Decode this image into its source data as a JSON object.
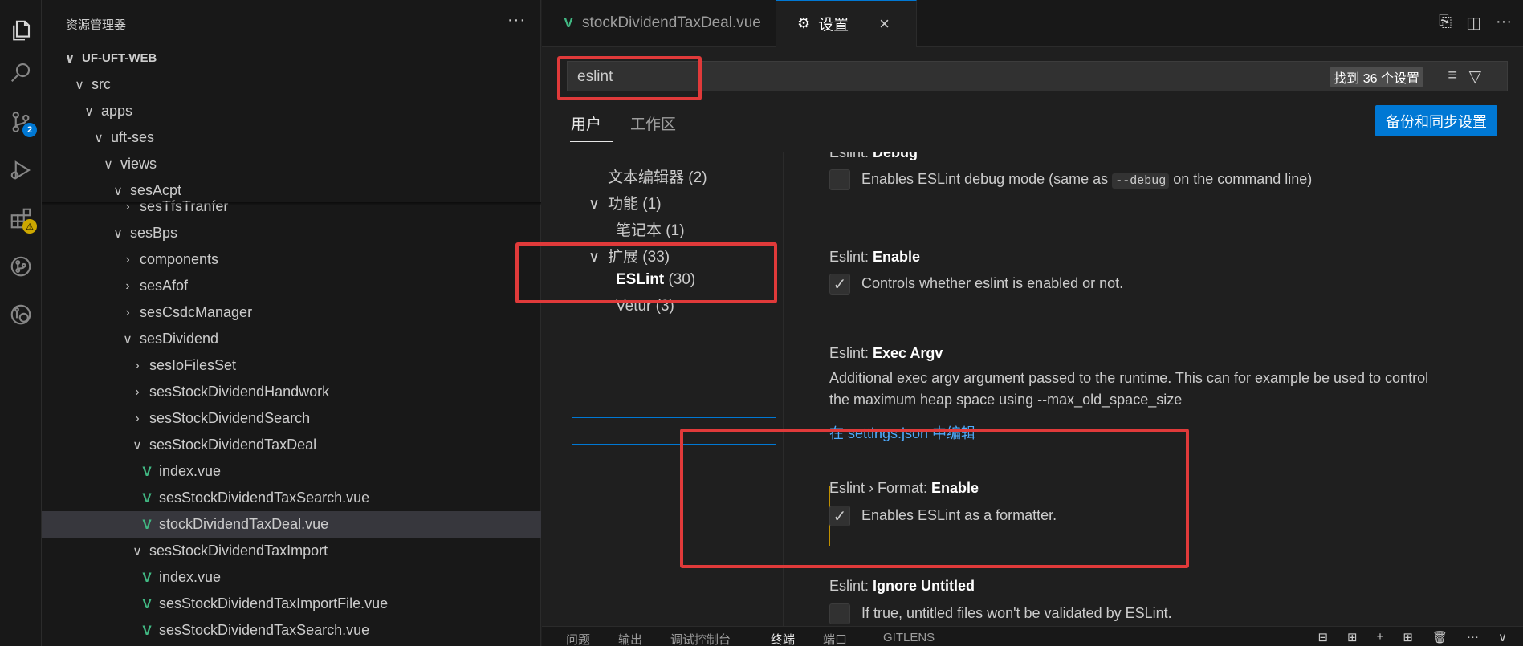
{
  "activity": {
    "source_control_badge": "2",
    "extensions_badge": "⚠"
  },
  "sidebar": {
    "title": "资源管理器",
    "more": "···",
    "tree": [
      {
        "label": "UF-UFT-WEB",
        "depth": 0,
        "chevron": "∨",
        "icon": "",
        "bold": true
      },
      {
        "label": "src",
        "depth": 1,
        "chevron": "∨",
        "icon": ""
      },
      {
        "label": "apps",
        "depth": 2,
        "chevron": "∨",
        "icon": ""
      },
      {
        "label": "uft-ses",
        "depth": 3,
        "chevron": "∨",
        "icon": ""
      },
      {
        "label": "views",
        "depth": 4,
        "chevron": "∨",
        "icon": ""
      },
      {
        "label": "sesAcpt",
        "depth": 5,
        "chevron": "∨",
        "icon": ""
      },
      {
        "label": "sesTfsTranfer",
        "depth": 6,
        "chevron": "›",
        "icon": ""
      },
      {
        "label": "sesBps",
        "depth": 5,
        "chevron": "∨",
        "icon": ""
      },
      {
        "label": "components",
        "depth": 6,
        "chevron": "›",
        "icon": ""
      },
      {
        "label": "sesAfof",
        "depth": 6,
        "chevron": "›",
        "icon": ""
      },
      {
        "label": "sesCsdcManager",
        "depth": 6,
        "chevron": "›",
        "icon": ""
      },
      {
        "label": "sesDividend",
        "depth": 6,
        "chevron": "∨",
        "icon": ""
      },
      {
        "label": "sesIoFilesSet",
        "depth": 7,
        "chevron": "›",
        "icon": ""
      },
      {
        "label": "sesStockDividendHandwork",
        "depth": 7,
        "chevron": "›",
        "icon": ""
      },
      {
        "label": "sesStockDividendSearch",
        "depth": 7,
        "chevron": "›",
        "icon": ""
      },
      {
        "label": "sesStockDividendTaxDeal",
        "depth": 7,
        "chevron": "∨",
        "icon": ""
      },
      {
        "label": "index.vue",
        "depth": 8,
        "chevron": "",
        "icon": "V"
      },
      {
        "label": "sesStockDividendTaxSearch.vue",
        "depth": 8,
        "chevron": "",
        "icon": "V"
      },
      {
        "label": "stockDividendTaxDeal.vue",
        "depth": 8,
        "chevron": "",
        "icon": "V",
        "selected": true
      },
      {
        "label": "sesStockDividendTaxImport",
        "depth": 7,
        "chevron": "∨",
        "icon": ""
      },
      {
        "label": "index.vue",
        "depth": 8,
        "chevron": "",
        "icon": "V"
      },
      {
        "label": "sesStockDividendTaxImportFile.vue",
        "depth": 8,
        "chevron": "",
        "icon": "V"
      },
      {
        "label": "sesStockDividendTaxSearch.vue",
        "depth": 8,
        "chevron": "",
        "icon": "V"
      }
    ]
  },
  "tabs": [
    {
      "label": "stockDividendTaxDeal.vue",
      "icon": "V"
    },
    {
      "label": "设置",
      "icon": "⚙",
      "close": "×"
    }
  ],
  "search": {
    "value": "eslint",
    "result_count": "找到 36 个设置"
  },
  "scope_tabs": [
    "用户",
    "工作区"
  ],
  "backup_button": "备份和同步设置",
  "toc": [
    {
      "label": "文本编辑器",
      "count": "(2)",
      "chevron": ""
    },
    {
      "label": "功能",
      "count": "(1)",
      "chevron": "∨"
    },
    {
      "label": "笔记本",
      "count": "(1)",
      "chevron": ""
    },
    {
      "label": "扩展",
      "count": "(33)",
      "chevron": "∨"
    },
    {
      "label": "ESLint",
      "count": "(30)",
      "chevron": ""
    },
    {
      "label": "Vetur",
      "count": "(3)",
      "chevron": ""
    }
  ],
  "settings": {
    "debug": {
      "category": "Eslint: ",
      "name": "Debug",
      "desc_before": "Enables ESLint debug mode (same as ",
      "code": "--debug",
      "desc_after": " on the command line)",
      "checked": false
    },
    "enable": {
      "category": "Eslint: ",
      "name": "Enable",
      "desc": "Controls whether eslint is enabled or not.",
      "checked": true
    },
    "exec_argv": {
      "category": "Eslint: ",
      "name": "Exec Argv",
      "desc_line1": "Additional exec argv argument passed to the runtime. This can for example be used to control",
      "desc_line2": "the maximum heap space using --max_old_space_size",
      "link": "在 settings.json 中编辑"
    },
    "format_enable": {
      "category": "Eslint › Format: ",
      "name": "Enable",
      "desc": "Enables ESLint as a formatter.",
      "checked": true
    },
    "ignore_untitled": {
      "category": "Eslint: ",
      "name": "Ignore Untitled",
      "desc": "If true, untitled files won't be validated by ESLint.",
      "checked": false
    }
  },
  "panel_tabs": [
    "问题",
    "输出",
    "调试控制台",
    "终端",
    "端口",
    "GITLENS"
  ],
  "colors": {
    "accent": "#0078d4",
    "highlight_box": "#e03a3a",
    "vue_green": "#41b883"
  }
}
